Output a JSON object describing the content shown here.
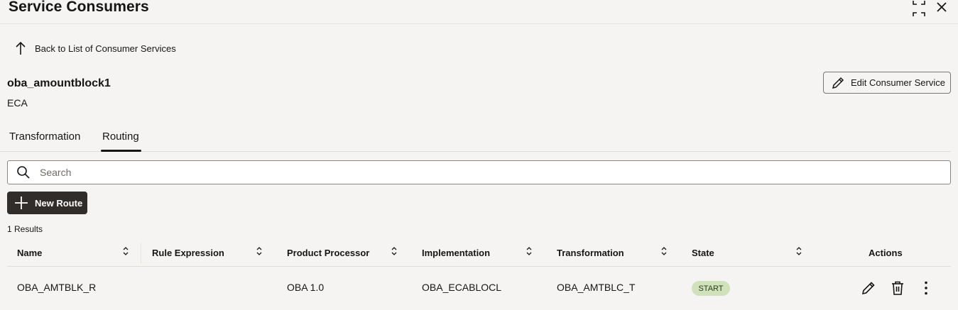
{
  "header": {
    "title": "Service Consumers",
    "icons": {
      "collapse": "collapse-icon",
      "close": "close-icon"
    }
  },
  "back_link": {
    "label": "Back to List of Consumer Services",
    "icon": "arrow-up-icon"
  },
  "service": {
    "name": "oba_amountblock1",
    "type": "ECA"
  },
  "edit_button": {
    "label": "Edit Consumer Service",
    "icon": "pencil-icon"
  },
  "tabs": [
    {
      "label": "Transformation",
      "active": false
    },
    {
      "label": "Routing",
      "active": true
    }
  ],
  "search": {
    "placeholder": "Search",
    "value": ""
  },
  "new_route_button": {
    "label": "New Route",
    "icon": "plus-icon"
  },
  "results": {
    "label": "1 Results"
  },
  "table": {
    "columns": [
      "Name",
      "Rule Expression",
      "Product Processor",
      "Implementation",
      "Transformation",
      "State",
      "Actions"
    ],
    "rows": [
      {
        "name": "OBA_AMTBLK_R",
        "rule_expression": "",
        "product_processor": "OBA 1.0",
        "implementation": "OBA_ECABLOCL",
        "transformation": "OBA_AMTBLC_T",
        "state": "START"
      }
    ]
  },
  "colors": {
    "primary_button": "#312d2a",
    "state_badge": "#cfe2bb",
    "background": "#f5f4f2"
  }
}
